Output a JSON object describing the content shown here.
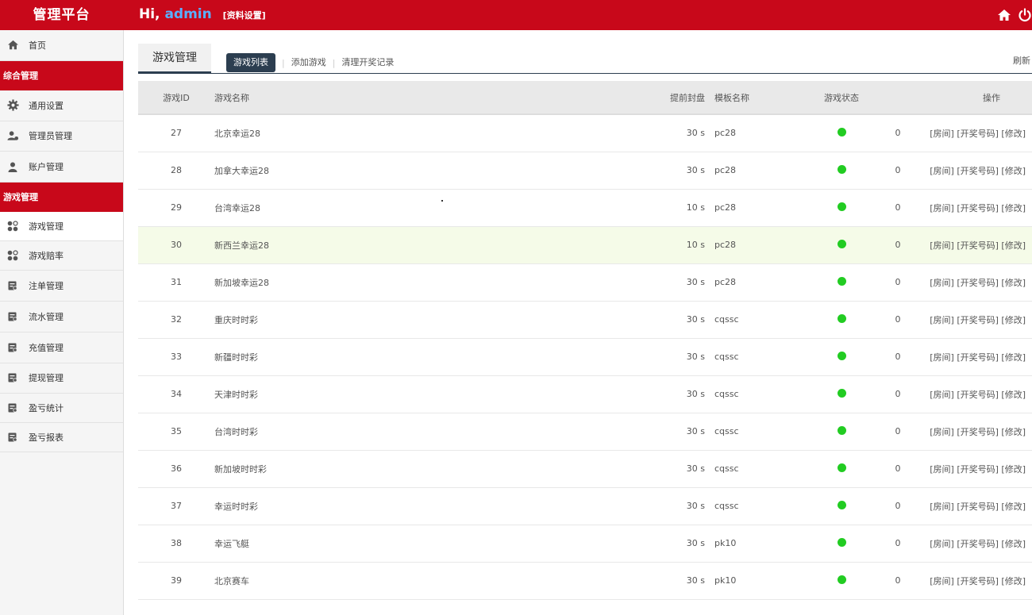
{
  "header": {
    "brand": "管理平台",
    "greeting": "Hi,",
    "username": "admin",
    "profile_link": "[资料设置]",
    "icons": [
      "home-icon",
      "power-icon"
    ],
    "bg_color": "#c8081a"
  },
  "sidebar": {
    "home": {
      "label": "首页",
      "icon": "home-icon"
    },
    "section1": "综合管理",
    "group1": [
      {
        "label": "通用设置",
        "icon": "gear-icon"
      },
      {
        "label": "管理员管理",
        "icon": "users-icon"
      },
      {
        "label": "账户管理",
        "icon": "user-icon"
      }
    ],
    "section2": "游戏管理",
    "group2": [
      {
        "label": "游戏管理",
        "icon": "grid-icon"
      },
      {
        "label": "游戏赔率",
        "icon": "grid-icon"
      },
      {
        "label": "注单管理",
        "icon": "doc-icon"
      },
      {
        "label": "流水管理",
        "icon": "doc-icon"
      },
      {
        "label": "充值管理",
        "icon": "doc-icon"
      },
      {
        "label": "提现管理",
        "icon": "doc-icon"
      },
      {
        "label": "盈亏统计",
        "icon": "doc-icon"
      },
      {
        "label": "盈亏报表",
        "icon": "doc-icon"
      }
    ]
  },
  "main": {
    "title_tab": "游戏管理",
    "tabs": [
      {
        "label": "游戏列表"
      },
      {
        "label": "添加游戏"
      },
      {
        "label": "清理开奖记录"
      }
    ],
    "refresh": "刷新",
    "columns": [
      "游戏ID",
      "游戏名称",
      "提前封盘",
      "模板名称",
      "游戏状态",
      "操作"
    ],
    "row_actions": {
      "room": "[房间]",
      "draw": "[开奖号码]",
      "edit": "[修改]"
    },
    "rows": [
      {
        "id": "27",
        "name": "北京幸运28",
        "seal": "30 s",
        "tpl": "pc28",
        "count": "0"
      },
      {
        "id": "28",
        "name": "加拿大幸运28",
        "seal": "30 s",
        "tpl": "pc28",
        "count": "0"
      },
      {
        "id": "29",
        "name": "台湾幸运28",
        "seal": "10 s",
        "tpl": "pc28",
        "count": "0"
      },
      {
        "id": "30",
        "name": "新西兰幸运28",
        "seal": "10 s",
        "tpl": "pc28",
        "count": "0"
      },
      {
        "id": "31",
        "name": "新加坡幸运28",
        "seal": "30 s",
        "tpl": "pc28",
        "count": "0"
      },
      {
        "id": "32",
        "name": "重庆时时彩",
        "seal": "30 s",
        "tpl": "cqssc",
        "count": "0"
      },
      {
        "id": "33",
        "name": "新疆时时彩",
        "seal": "30 s",
        "tpl": "cqssc",
        "count": "0"
      },
      {
        "id": "34",
        "name": "天津时时彩",
        "seal": "30 s",
        "tpl": "cqssc",
        "count": "0"
      },
      {
        "id": "35",
        "name": "台湾时时彩",
        "seal": "30 s",
        "tpl": "cqssc",
        "count": "0"
      },
      {
        "id": "36",
        "name": "新加坡时时彩",
        "seal": "30 s",
        "tpl": "cqssc",
        "count": "0"
      },
      {
        "id": "37",
        "name": "幸运时时彩",
        "seal": "30 s",
        "tpl": "cqssc",
        "count": "0"
      },
      {
        "id": "38",
        "name": "幸运飞艇",
        "seal": "30 s",
        "tpl": "pk10",
        "count": "0"
      },
      {
        "id": "39",
        "name": "北京赛车",
        "seal": "30 s",
        "tpl": "pk10",
        "count": "0"
      }
    ],
    "status_color": "#22cc22",
    "highlight_row_color": "#f5fbe8"
  }
}
